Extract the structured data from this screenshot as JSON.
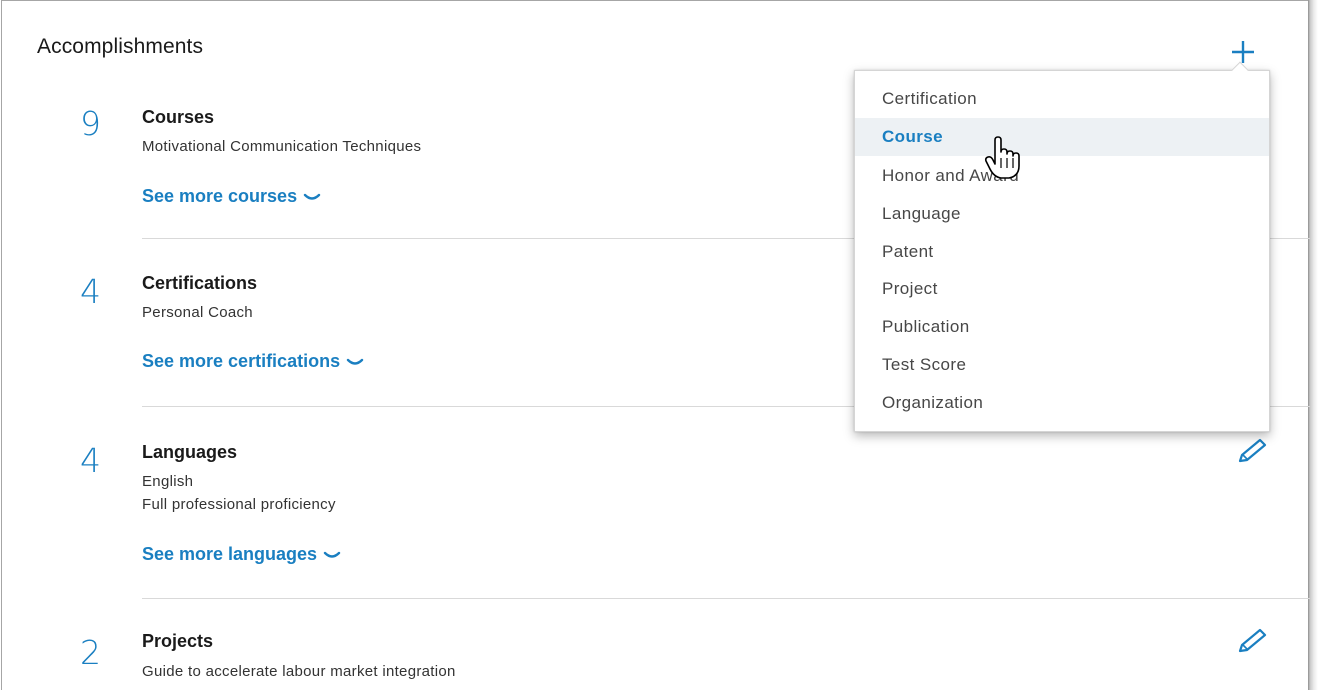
{
  "accomplishments": {
    "title": "Accomplishments",
    "add_icon": "plus-icon",
    "accent_color": "#1a7fc1",
    "sections": [
      {
        "count": "9",
        "title": "Courses",
        "lines": [
          "Motivational Communication Techniques"
        ],
        "see_more": "See more courses"
      },
      {
        "count": "4",
        "title": "Certifications",
        "lines": [
          "Personal Coach"
        ],
        "see_more": "See more certifications"
      },
      {
        "count": "4",
        "title": "Languages",
        "lines": [
          "English",
          "Full professional proficiency"
        ],
        "see_more": "See more languages",
        "edit_icon": "pencil-icon"
      },
      {
        "count": "2",
        "title": "Projects",
        "lines": [
          "Guide to accelerate labour market integration"
        ],
        "edit_icon": "pencil-icon"
      }
    ]
  },
  "add_menu": {
    "items": [
      {
        "label": "Certification",
        "active": false
      },
      {
        "label": "Course",
        "active": true
      },
      {
        "label": "Honor and Award",
        "active": false
      },
      {
        "label": "Language",
        "active": false
      },
      {
        "label": "Patent",
        "active": false
      },
      {
        "label": "Project",
        "active": false
      },
      {
        "label": "Publication",
        "active": false
      },
      {
        "label": "Test Score",
        "active": false
      },
      {
        "label": "Organization",
        "active": false
      }
    ],
    "hover_highlight": "#edf1f4"
  }
}
